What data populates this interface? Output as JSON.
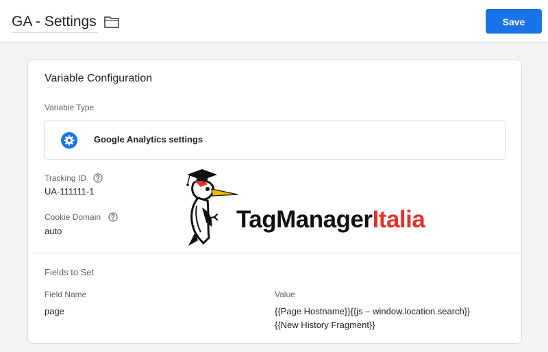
{
  "header": {
    "title": "GA - Settings",
    "folder_icon": "folder-icon",
    "save_label": "Save",
    "accent_color": "#1a73e8"
  },
  "card": {
    "section_title": "Variable Configuration",
    "variable_type_label": "Variable Type",
    "variable_type_icon": "gear-icon",
    "variable_type_value": "Google Analytics settings",
    "tracking_id_label": "Tracking ID",
    "tracking_id_value": "UA-111111-1",
    "cookie_domain_label": "Cookie Domain",
    "cookie_domain_value": "auto",
    "help_icon": "question-circle-icon",
    "fields_to_set": {
      "title": "Fields to Set",
      "columns": {
        "name": "Field Name",
        "value": "Value"
      },
      "rows": [
        {
          "name": "page",
          "value_line1": "{{Page Hostname}}{{js – window.location.search}}",
          "value_line2": "{{New History Fragment}}"
        }
      ]
    }
  },
  "watermark": {
    "logo_icon": "woodpecker-mascot-icon",
    "text_dark": "TagManager",
    "text_red": "Italia",
    "red_color": "#e6312a"
  }
}
